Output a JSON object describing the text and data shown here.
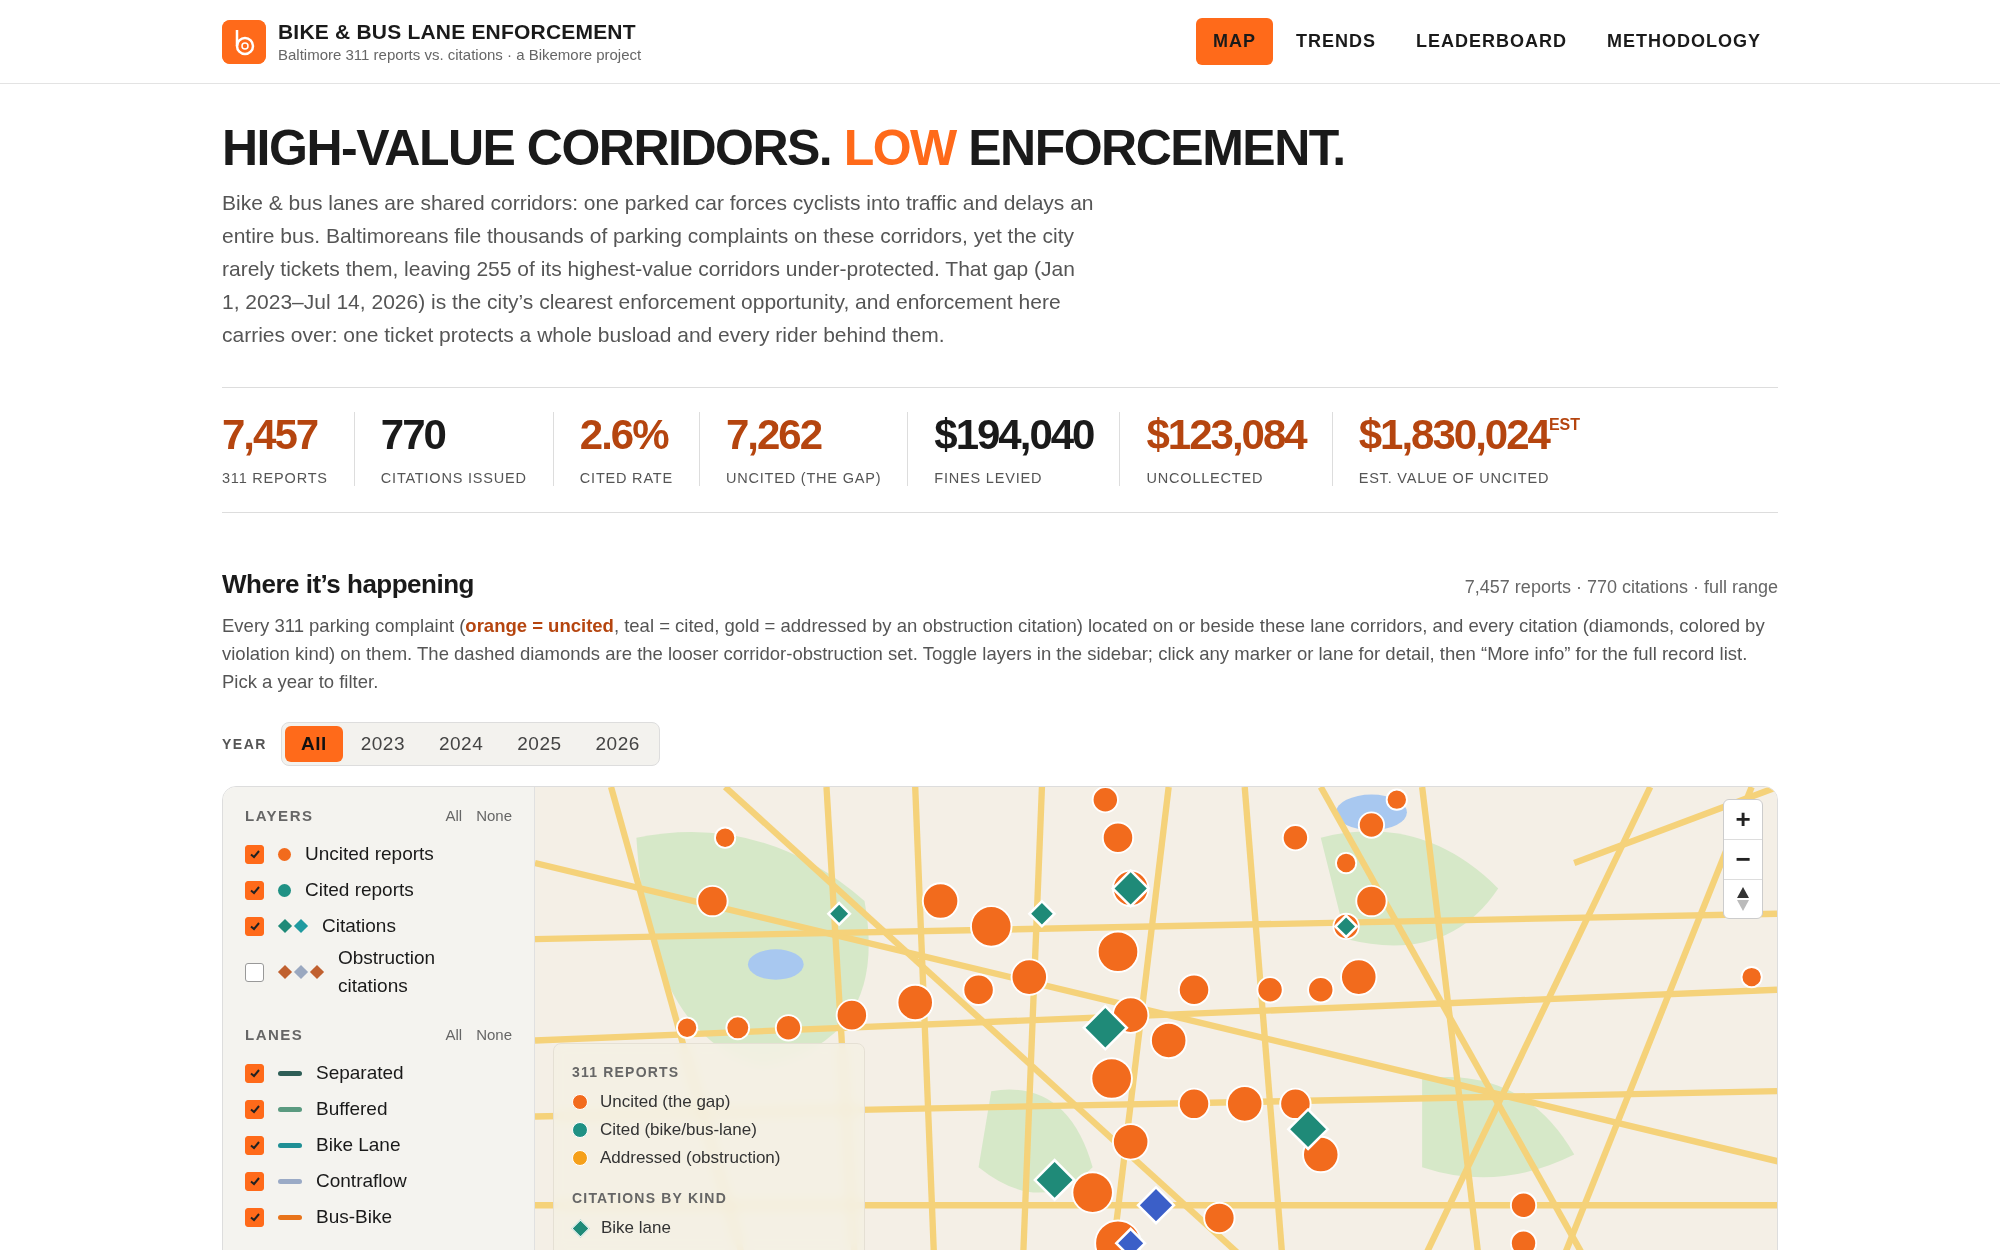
{
  "header": {
    "title": "BIKE & BUS LANE ENFORCEMENT",
    "subtitle": "Baltimore 311 reports vs. citations · a Bikemore project",
    "nav": [
      {
        "label": "MAP",
        "selected": true
      },
      {
        "label": "TRENDS",
        "selected": false
      },
      {
        "label": "LEADERBOARD",
        "selected": false
      },
      {
        "label": "METHODOLOGY",
        "selected": false
      }
    ]
  },
  "hero": {
    "headline_start": "HIGH-VALUE CORRIDORS.",
    "headline_accent": "LOW",
    "headline_end": "ENFORCEMENT.",
    "intro": "Bike & bus lanes are shared corridors: one parked car forces cyclists into traffic and delays an entire bus. Baltimoreans file thousands of parking complaints on these corridors, yet the city rarely tickets them, leaving 255 of its highest-value corridors under-protected. That gap (Jan 1, 2023–Jul 14, 2026) is the city’s clearest enforcement opportunity, and enforcement here carries over: one ticket protects a whole busload and every rider behind them."
  },
  "stats": [
    {
      "value": "7,457",
      "label": "311 REPORTS",
      "color": "#b5450f"
    },
    {
      "value": "770",
      "label": "CITATIONS ISSUED",
      "color": "#1a1a1a"
    },
    {
      "value": "2.6%",
      "label": "CITED RATE",
      "color": "#b5450f"
    },
    {
      "value": "7,262",
      "label": "UNCITED (THE GAP)",
      "color": "#b5450f"
    },
    {
      "value": "$194,040",
      "label": "FINES LEVIED",
      "color": "#1a1a1a"
    },
    {
      "value": "$123,084",
      "label": "UNCOLLECTED",
      "color": "#b5450f"
    },
    {
      "value": "$1,830,024$^{EST}$",
      "label": "EST. VALUE OF UNCITED",
      "color": "#b5450f"
    }
  ],
  "section": {
    "title": "Where it’s happening",
    "meta": "7,457 reports · 770 citations · full range",
    "description": "Every 311 parking complaint (**orange = uncited**, teal = cited, gold = addressed by an obstruction citation) located on or beside these lane corridors, and every citation (diamonds, colored by violation kind) on them. The dashed diamonds are the looser corridor-obstruction set. Toggle layers in the sidebar; click any marker or lane for detail, then “More info” for the full record list. Pick a year to filter.",
    "year_label": "YEAR",
    "years": [
      {
        "label": "All",
        "selected": true
      },
      {
        "label": "2023",
        "selected": false
      },
      {
        "label": "2024",
        "selected": false
      },
      {
        "label": "2025",
        "selected": false
      },
      {
        "label": "2026",
        "selected": false
      }
    ]
  },
  "sidebar": {
    "layers": {
      "title": "LAYERS",
      "all": "All",
      "none": "None",
      "items": [
        {
          "label": "Uncited reports",
          "checked": true,
          "kind": "dot",
          "swatches": [
            {
              "color": "#f26b1d"
            }
          ]
        },
        {
          "label": "Cited reports",
          "checked": true,
          "kind": "dot",
          "swatches": [
            {
              "color": "#1f9184"
            }
          ]
        },
        {
          "label": "Citations",
          "checked": true,
          "kind": "diamonds",
          "swatches": [
            {
              "color": "#1f8a78"
            },
            {
              "color": "#1f9aa0"
            }
          ]
        },
        {
          "label": "Obstruction citations",
          "checked": false,
          "kind": "diamonds",
          "swatches": [
            {
              "color": "#c0602f"
            },
            {
              "color": "#9aa8c0"
            },
            {
              "color": "#c0602f"
            }
          ]
        }
      ]
    },
    "lanes": {
      "title": "LANES",
      "all": "All",
      "none": "None",
      "items": [
        {
          "label": "Separated",
          "checked": true,
          "color": "#2e5e57"
        },
        {
          "label": "Buffered",
          "checked": true,
          "color": "#5a9a80"
        },
        {
          "label": "Bike Lane",
          "checked": true,
          "color": "#1f8f95"
        },
        {
          "label": "Contraflow",
          "checked": true,
          "color": "#9aaac6"
        },
        {
          "label": "Bus-Bike",
          "checked": true,
          "color": "#e8731a"
        }
      ]
    }
  },
  "map": {
    "zoom_in": "+",
    "zoom_out": "−",
    "legend": {
      "reports_title": "311 REPORTS",
      "reports": [
        {
          "label": "Uncited (the gap)",
          "color": "#f26b1d"
        },
        {
          "label": "Cited (bike/bus-lane)",
          "color": "#1f9184"
        },
        {
          "label": "Addressed (obstruction)",
          "color": "#f5a01a"
        }
      ],
      "citations_title": "CITATIONS BY KIND",
      "citations": [
        {
          "label": "Bike lane",
          "color": "#1f8a78"
        }
      ]
    }
  }
}
